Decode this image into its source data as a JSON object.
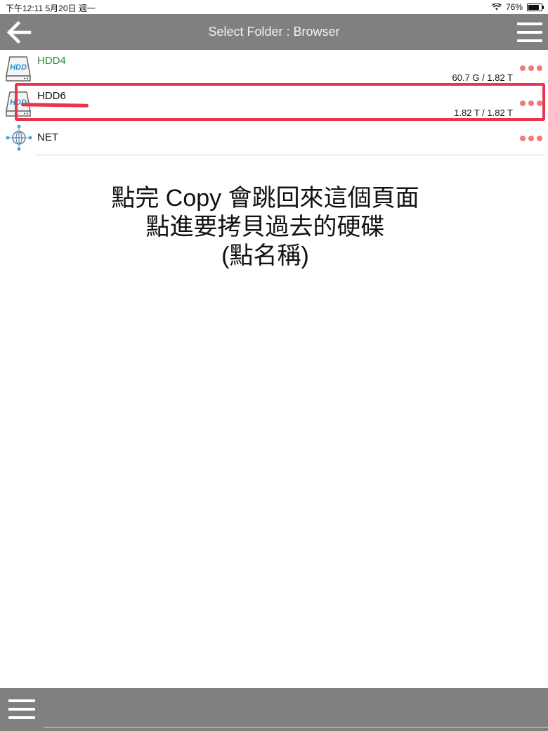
{
  "status_bar": {
    "time_date": "下午12:11   5月20日 週一",
    "battery": "76%",
    "battery_level": 0.76
  },
  "header": {
    "title": "Select Folder : Browser",
    "back_icon": "arrow-left-icon",
    "menu_icon": "hamburger-menu-icon"
  },
  "drives": [
    {
      "name": "HDD4",
      "size": "60.7 G / 1.82 T",
      "icon": "hdd-icon",
      "name_color": "#2e8b2e"
    },
    {
      "name": "HDD6",
      "size": "1.82 T / 1.82 T",
      "icon": "hdd-icon",
      "name_color": "#111111"
    },
    {
      "name": "NET",
      "size": "",
      "icon": "globe-network-icon",
      "name_color": "#111111"
    }
  ],
  "annotation": {
    "line1": "點完 Copy 會跳回來這個頁面",
    "line2": "點進要拷貝過去的硬碟",
    "line3": "(點名稱)",
    "color": "#e8344e"
  },
  "footer": {
    "menu_icon": "hamburger-menu-icon"
  }
}
